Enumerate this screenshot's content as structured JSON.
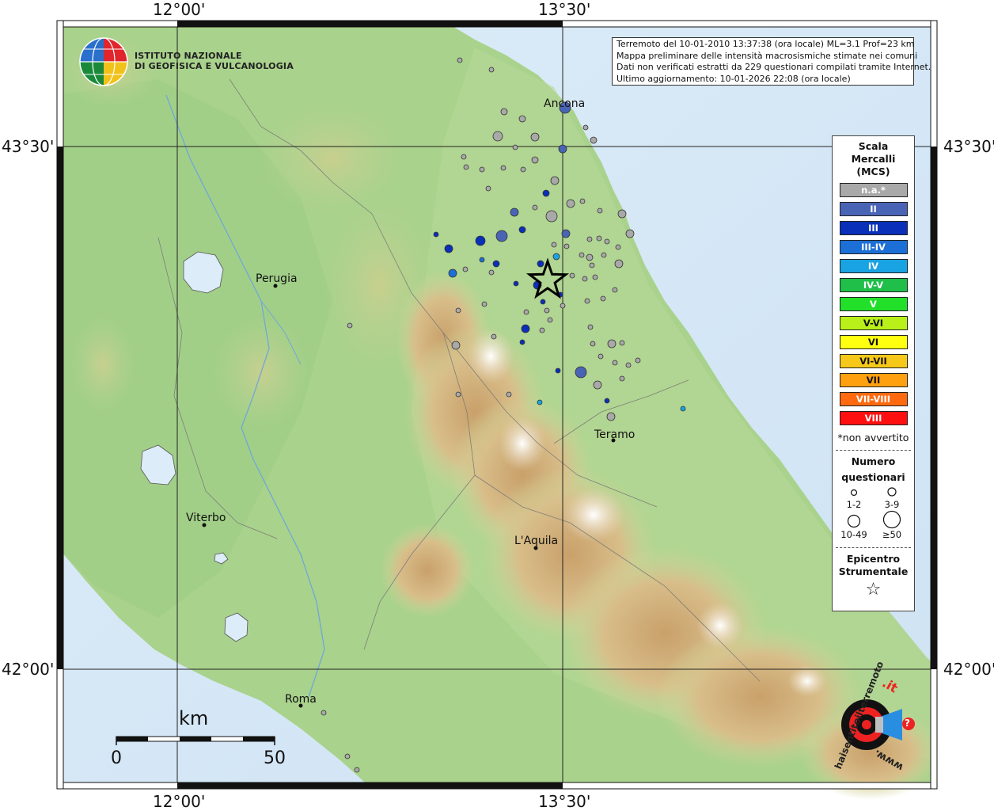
{
  "coords": {
    "top_left": "12°00'",
    "top_right": "13°30'",
    "bottom_left": "12°00'",
    "bottom_right": "13°30'",
    "left_top": "43°30'",
    "left_bottom": "42°00'",
    "right_top": "43°30'",
    "right_bottom": "42°00'"
  },
  "logo": {
    "line1": "ISTITUTO NAZIONALE",
    "line2": "DI GEOFISICA E VULCANOLOGIA"
  },
  "info": {
    "line1": "Terremoto del 10-01-2010 13:37:38 (ora locale) ML=3.1 Prof=23 km",
    "line2": "Mappa preliminare delle intensità macrosismiche stimate nei comuni",
    "line3": "Dati non verificati estratti da 229 questionari compilati tramite Internet.",
    "line4": "Ultimo aggiornamento: 10-01-2026 22:08 (ora locale)"
  },
  "cities": {
    "ancona": "Ancona",
    "perugia": "Perugia",
    "teramo": "Teramo",
    "viterbo": "Viterbo",
    "laquila": "L'Aquila",
    "roma": "Roma"
  },
  "legend": {
    "title1": "Scala",
    "title2": "Mercalli",
    "title3": "(MCS)",
    "levels": [
      {
        "label": "n.a.*",
        "color": "#a9a9a9"
      },
      {
        "label": "II",
        "color": "#4a64b5"
      },
      {
        "label": "III",
        "color": "#0a2fb8"
      },
      {
        "label": "III-IV",
        "color": "#1c6fd6"
      },
      {
        "label": "IV",
        "color": "#1aa3e2"
      },
      {
        "label": "IV-V",
        "color": "#1fbf4a"
      },
      {
        "label": "V",
        "color": "#22e02a"
      },
      {
        "label": "V-VI",
        "color": "#b9f01a"
      },
      {
        "label": "VI",
        "color": "#ffff10"
      },
      {
        "label": "VI-VII",
        "color": "#f6c81a"
      },
      {
        "label": "VII",
        "color": "#ffa010"
      },
      {
        "label": "VII-VIII",
        "color": "#ff6a10"
      },
      {
        "label": "VIII",
        "color": "#ff1010"
      }
    ],
    "footnote": "*non avvertito",
    "num_title1": "Numero",
    "num_title2": "questionari",
    "size1": "1-2",
    "size2": "3-9",
    "size3": "10-49",
    "size4": "≥50",
    "epi1": "Epicentro",
    "epi2": "Strumentale",
    "star": "☆"
  },
  "scalebar": {
    "unit": "km",
    "start": "0",
    "end": "50"
  },
  "badge": {
    "text1": "haisentitoilterremoto",
    "text2": ".it",
    "text3": "www.",
    "text4": "?"
  }
}
